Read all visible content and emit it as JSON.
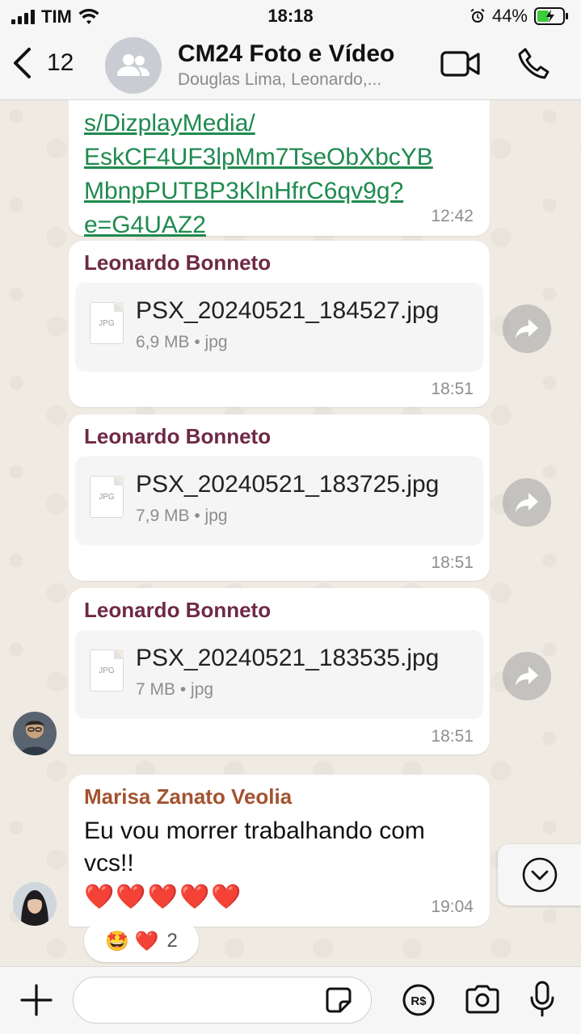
{
  "status_bar": {
    "carrier": "TIM",
    "time": "18:18",
    "battery": "44%"
  },
  "header": {
    "back_count": "12",
    "title": "CM24 Foto e Vídeo",
    "subtitle": "Douglas Lima, Leonardo,..."
  },
  "link_message": {
    "lines": [
      "s/DizplayMedia/",
      "EskCF4UF3lpMm7TseObXbcYB",
      "MbnpPUTBP3KlnHfrC6qv9g?",
      "e=G4UAZ2"
    ],
    "time": "12:42"
  },
  "file_messages": [
    {
      "sender": "Leonardo Bonneto",
      "icon_label": "JPG",
      "file_name": "PSX_20240521_184527.jpg",
      "meta": "6,9 MB • jpg",
      "time": "18:51"
    },
    {
      "sender": "Leonardo Bonneto",
      "icon_label": "JPG",
      "file_name": "PSX_20240521_183725.jpg",
      "meta": "7,9 MB • jpg",
      "time": "18:51"
    },
    {
      "sender": "Leonardo Bonneto",
      "icon_label": "JPG",
      "file_name": "PSX_20240521_183535.jpg",
      "meta": "7 MB • jpg",
      "time": "18:51"
    }
  ],
  "text_message": {
    "sender": "Marisa Zanato Veolia",
    "line1": "Eu vou morrer trabalhando com",
    "line2": "vcs!!",
    "emojis": "❤️❤️❤️❤️❤️",
    "time": "19:04"
  },
  "reaction": {
    "emojis": "🤩 ❤️",
    "count": "2"
  },
  "colors": {
    "sender_leonardo": "#6e2a45",
    "sender_marisa": "#a3532f",
    "link": "#1f8a4f",
    "chat_bg": "#efeae2"
  },
  "input": {
    "placeholder": ""
  }
}
